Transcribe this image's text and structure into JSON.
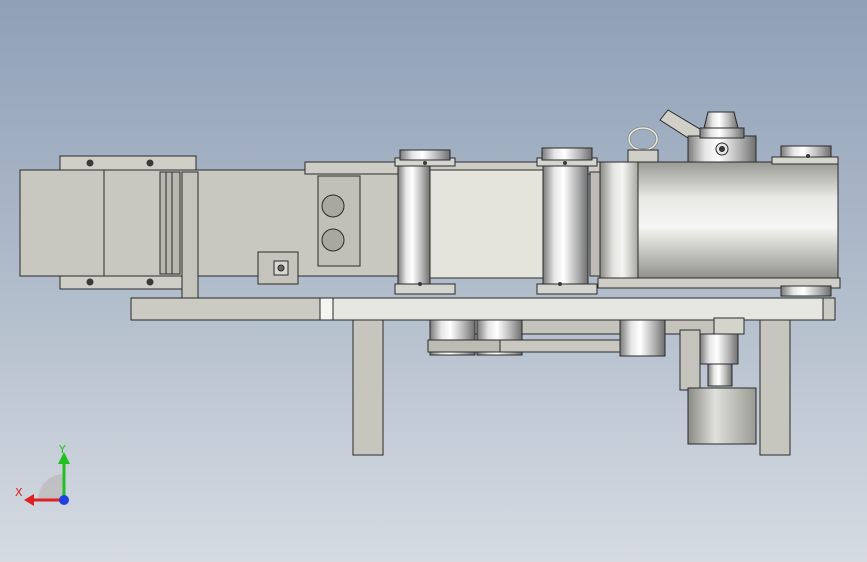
{
  "viewport": {
    "background_top": "#8fa0b7",
    "background_bottom": "#d6dbe2"
  },
  "model": {
    "part_color": "#c8c8c0",
    "edge_color": "#2a2a2a",
    "metal_light": "#f2f2f2",
    "metal_dark": "#8c8c8c"
  },
  "triad": {
    "x_label": "X",
    "y_label": "Y",
    "x_color": "#e02020",
    "y_color": "#20c020",
    "z_color": "#2040e0"
  }
}
